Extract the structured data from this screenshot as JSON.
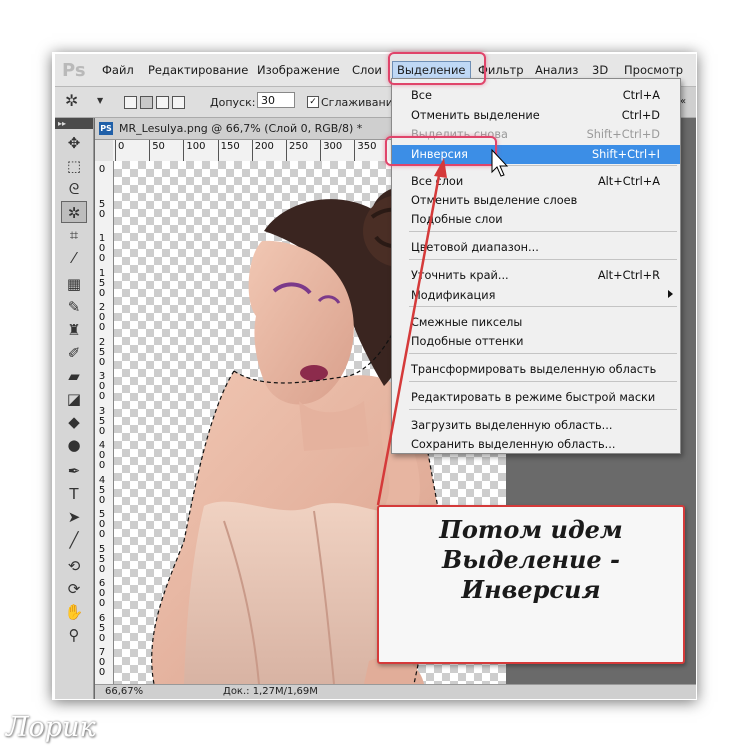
{
  "app": {
    "logo": "Ps",
    "menu": [
      "Файл",
      "Редактирование",
      "Изображение",
      "Слои",
      "Выделение",
      "Фильтр",
      "Анализ",
      "3D",
      "Просмотр"
    ],
    "active_menu": "Выделение"
  },
  "options": {
    "tolerance_label": "Допуск:",
    "tolerance_value": "30",
    "antialias_label": "Сглаживание",
    "right_fragment": "« кр"
  },
  "document": {
    "title": "MR_Lesulya.png @ 66,7% (Слой 0, RGB/8) *",
    "icon_text": "PS"
  },
  "ruler": {
    "h_labels": [
      "0",
      "50",
      "100",
      "150",
      "200",
      "250",
      "300",
      "350"
    ],
    "v_labels": [
      "0",
      "5 0",
      "1 0 0",
      "1 5 0",
      "2 0 0",
      "2 5 0",
      "3 0 0",
      "3 5 0",
      "4 0 0",
      "4 5 0",
      "5 0 0",
      "5 5 0",
      "6 0 0",
      "6 5 0",
      "7 0 0"
    ]
  },
  "status": {
    "zoom": "66,67%",
    "doc": "Док.: 1,27M/1,69M"
  },
  "select_menu": {
    "items": [
      {
        "label": "Все",
        "shortcut": "Ctrl+A"
      },
      {
        "label": "Отменить выделение",
        "shortcut": "Ctrl+D"
      },
      {
        "label": "Выделить снова",
        "shortcut": "Shift+Ctrl+D",
        "disabled": true
      },
      {
        "label": "Инверсия",
        "shortcut": "Shift+Ctrl+I",
        "highlighted": true
      },
      {
        "label": "Все слои",
        "shortcut": "Alt+Ctrl+A"
      },
      {
        "label": "Отменить выделение слоев",
        "shortcut": ""
      },
      {
        "label": "Подобные слои",
        "shortcut": ""
      },
      {
        "label": "Цветовой диапазон...",
        "shortcut": ""
      },
      {
        "label": "Уточнить край...",
        "shortcut": "Alt+Ctrl+R"
      },
      {
        "label": "Модификация",
        "shortcut": "",
        "submenu": true
      },
      {
        "label": "Смежные пикселы",
        "shortcut": ""
      },
      {
        "label": "Подобные оттенки",
        "shortcut": ""
      },
      {
        "label": "Трансформировать выделенную область",
        "shortcut": ""
      },
      {
        "label": "Редактировать в режиме быстрой маски",
        "shortcut": ""
      },
      {
        "label": "Загрузить выделенную область...",
        "shortcut": ""
      },
      {
        "label": "Сохранить выделенную область...",
        "shortcut": ""
      }
    ]
  },
  "annotation": {
    "line1": "Потом идем",
    "line2": "Выделение -",
    "line3": "Инверсия",
    "color": "#d53a3a"
  },
  "watermark": "Лорик",
  "tools": [
    "move-icon",
    "marquee-icon",
    "lasso-icon",
    "magic-wand-icon",
    "crop-icon",
    "eyedropper-icon",
    "healing-brush-icon",
    "brush-icon",
    "clone-stamp-icon",
    "history-brush-icon",
    "eraser-icon",
    "gradient-icon",
    "blur-icon",
    "dodge-icon",
    "pen-icon",
    "type-icon",
    "path-select-icon",
    "line-tool-icon",
    "3d-rotate-icon",
    "3d-orbit-icon",
    "hand-icon",
    "zoom-icon"
  ],
  "colors": {
    "menu_highlight": "#3c8ee6",
    "annotation_outline": "#e0446a"
  }
}
